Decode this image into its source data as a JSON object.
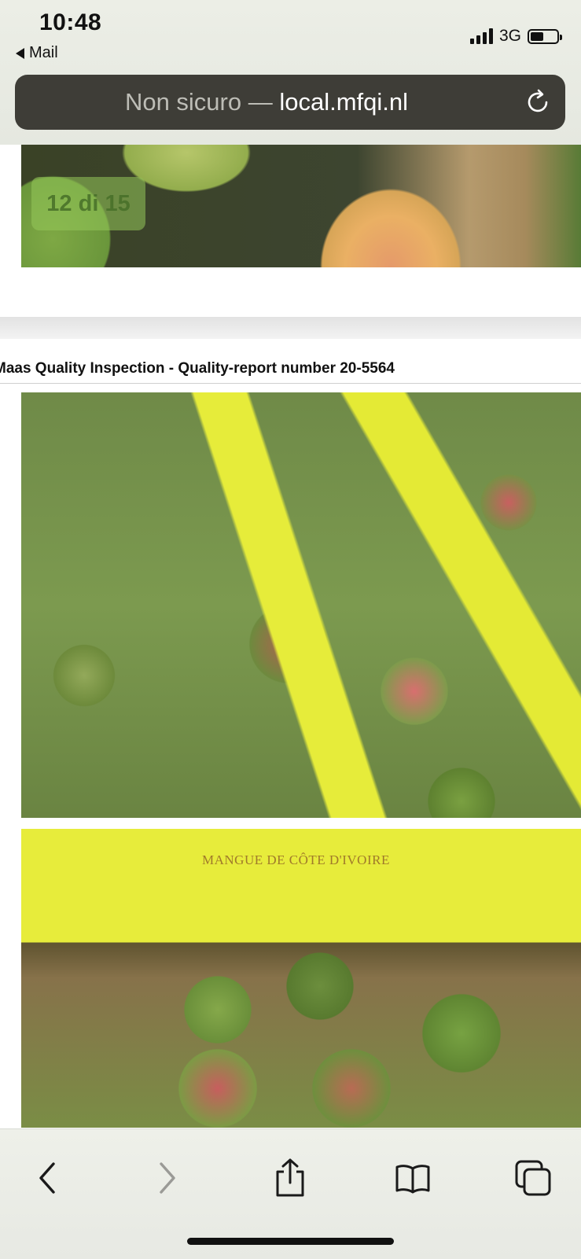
{
  "status_bar": {
    "time": "10:48",
    "back_app": "Mail",
    "network": "3G"
  },
  "address_bar": {
    "security_label": "Non sicuro —",
    "domain": "local.mfqi.nl"
  },
  "gallery": {
    "counter": "12 di 15"
  },
  "report": {
    "title": "Maas Quality Inspection - Quality-report number 20-5564"
  },
  "photo_text": {
    "box_print": "MANGUE DE CÔTE D'IVOIRE"
  },
  "colors": {
    "address_bar_bg": "#3e3d37",
    "counter_badge": "#96c85a"
  },
  "toolbar_icons": [
    "back-icon",
    "forward-icon",
    "share-icon",
    "bookmarks-icon",
    "tabs-icon"
  ]
}
